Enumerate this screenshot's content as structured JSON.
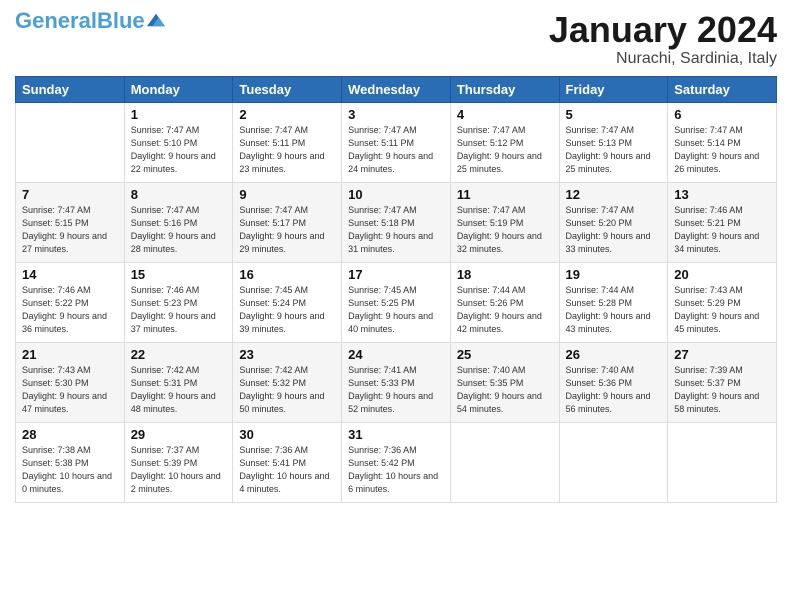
{
  "header": {
    "logo_general": "General",
    "logo_blue": "Blue",
    "month_title": "January 2024",
    "location": "Nurachi, Sardinia, Italy"
  },
  "days_of_week": [
    "Sunday",
    "Monday",
    "Tuesday",
    "Wednesday",
    "Thursday",
    "Friday",
    "Saturday"
  ],
  "weeks": [
    [
      {
        "day": "",
        "sunrise": "",
        "sunset": "",
        "daylight": ""
      },
      {
        "day": "1",
        "sunrise": "Sunrise: 7:47 AM",
        "sunset": "Sunset: 5:10 PM",
        "daylight": "Daylight: 9 hours and 22 minutes."
      },
      {
        "day": "2",
        "sunrise": "Sunrise: 7:47 AM",
        "sunset": "Sunset: 5:11 PM",
        "daylight": "Daylight: 9 hours and 23 minutes."
      },
      {
        "day": "3",
        "sunrise": "Sunrise: 7:47 AM",
        "sunset": "Sunset: 5:11 PM",
        "daylight": "Daylight: 9 hours and 24 minutes."
      },
      {
        "day": "4",
        "sunrise": "Sunrise: 7:47 AM",
        "sunset": "Sunset: 5:12 PM",
        "daylight": "Daylight: 9 hours and 25 minutes."
      },
      {
        "day": "5",
        "sunrise": "Sunrise: 7:47 AM",
        "sunset": "Sunset: 5:13 PM",
        "daylight": "Daylight: 9 hours and 25 minutes."
      },
      {
        "day": "6",
        "sunrise": "Sunrise: 7:47 AM",
        "sunset": "Sunset: 5:14 PM",
        "daylight": "Daylight: 9 hours and 26 minutes."
      }
    ],
    [
      {
        "day": "7",
        "sunrise": "Sunrise: 7:47 AM",
        "sunset": "Sunset: 5:15 PM",
        "daylight": "Daylight: 9 hours and 27 minutes."
      },
      {
        "day": "8",
        "sunrise": "Sunrise: 7:47 AM",
        "sunset": "Sunset: 5:16 PM",
        "daylight": "Daylight: 9 hours and 28 minutes."
      },
      {
        "day": "9",
        "sunrise": "Sunrise: 7:47 AM",
        "sunset": "Sunset: 5:17 PM",
        "daylight": "Daylight: 9 hours and 29 minutes."
      },
      {
        "day": "10",
        "sunrise": "Sunrise: 7:47 AM",
        "sunset": "Sunset: 5:18 PM",
        "daylight": "Daylight: 9 hours and 31 minutes."
      },
      {
        "day": "11",
        "sunrise": "Sunrise: 7:47 AM",
        "sunset": "Sunset: 5:19 PM",
        "daylight": "Daylight: 9 hours and 32 minutes."
      },
      {
        "day": "12",
        "sunrise": "Sunrise: 7:47 AM",
        "sunset": "Sunset: 5:20 PM",
        "daylight": "Daylight: 9 hours and 33 minutes."
      },
      {
        "day": "13",
        "sunrise": "Sunrise: 7:46 AM",
        "sunset": "Sunset: 5:21 PM",
        "daylight": "Daylight: 9 hours and 34 minutes."
      }
    ],
    [
      {
        "day": "14",
        "sunrise": "Sunrise: 7:46 AM",
        "sunset": "Sunset: 5:22 PM",
        "daylight": "Daylight: 9 hours and 36 minutes."
      },
      {
        "day": "15",
        "sunrise": "Sunrise: 7:46 AM",
        "sunset": "Sunset: 5:23 PM",
        "daylight": "Daylight: 9 hours and 37 minutes."
      },
      {
        "day": "16",
        "sunrise": "Sunrise: 7:45 AM",
        "sunset": "Sunset: 5:24 PM",
        "daylight": "Daylight: 9 hours and 39 minutes."
      },
      {
        "day": "17",
        "sunrise": "Sunrise: 7:45 AM",
        "sunset": "Sunset: 5:25 PM",
        "daylight": "Daylight: 9 hours and 40 minutes."
      },
      {
        "day": "18",
        "sunrise": "Sunrise: 7:44 AM",
        "sunset": "Sunset: 5:26 PM",
        "daylight": "Daylight: 9 hours and 42 minutes."
      },
      {
        "day": "19",
        "sunrise": "Sunrise: 7:44 AM",
        "sunset": "Sunset: 5:28 PM",
        "daylight": "Daylight: 9 hours and 43 minutes."
      },
      {
        "day": "20",
        "sunrise": "Sunrise: 7:43 AM",
        "sunset": "Sunset: 5:29 PM",
        "daylight": "Daylight: 9 hours and 45 minutes."
      }
    ],
    [
      {
        "day": "21",
        "sunrise": "Sunrise: 7:43 AM",
        "sunset": "Sunset: 5:30 PM",
        "daylight": "Daylight: 9 hours and 47 minutes."
      },
      {
        "day": "22",
        "sunrise": "Sunrise: 7:42 AM",
        "sunset": "Sunset: 5:31 PM",
        "daylight": "Daylight: 9 hours and 48 minutes."
      },
      {
        "day": "23",
        "sunrise": "Sunrise: 7:42 AM",
        "sunset": "Sunset: 5:32 PM",
        "daylight": "Daylight: 9 hours and 50 minutes."
      },
      {
        "day": "24",
        "sunrise": "Sunrise: 7:41 AM",
        "sunset": "Sunset: 5:33 PM",
        "daylight": "Daylight: 9 hours and 52 minutes."
      },
      {
        "day": "25",
        "sunrise": "Sunrise: 7:40 AM",
        "sunset": "Sunset: 5:35 PM",
        "daylight": "Daylight: 9 hours and 54 minutes."
      },
      {
        "day": "26",
        "sunrise": "Sunrise: 7:40 AM",
        "sunset": "Sunset: 5:36 PM",
        "daylight": "Daylight: 9 hours and 56 minutes."
      },
      {
        "day": "27",
        "sunrise": "Sunrise: 7:39 AM",
        "sunset": "Sunset: 5:37 PM",
        "daylight": "Daylight: 9 hours and 58 minutes."
      }
    ],
    [
      {
        "day": "28",
        "sunrise": "Sunrise: 7:38 AM",
        "sunset": "Sunset: 5:38 PM",
        "daylight": "Daylight: 10 hours and 0 minutes."
      },
      {
        "day": "29",
        "sunrise": "Sunrise: 7:37 AM",
        "sunset": "Sunset: 5:39 PM",
        "daylight": "Daylight: 10 hours and 2 minutes."
      },
      {
        "day": "30",
        "sunrise": "Sunrise: 7:36 AM",
        "sunset": "Sunset: 5:41 PM",
        "daylight": "Daylight: 10 hours and 4 minutes."
      },
      {
        "day": "31",
        "sunrise": "Sunrise: 7:36 AM",
        "sunset": "Sunset: 5:42 PM",
        "daylight": "Daylight: 10 hours and 6 minutes."
      },
      {
        "day": "",
        "sunrise": "",
        "sunset": "",
        "daylight": ""
      },
      {
        "day": "",
        "sunrise": "",
        "sunset": "",
        "daylight": ""
      },
      {
        "day": "",
        "sunrise": "",
        "sunset": "",
        "daylight": ""
      }
    ]
  ]
}
